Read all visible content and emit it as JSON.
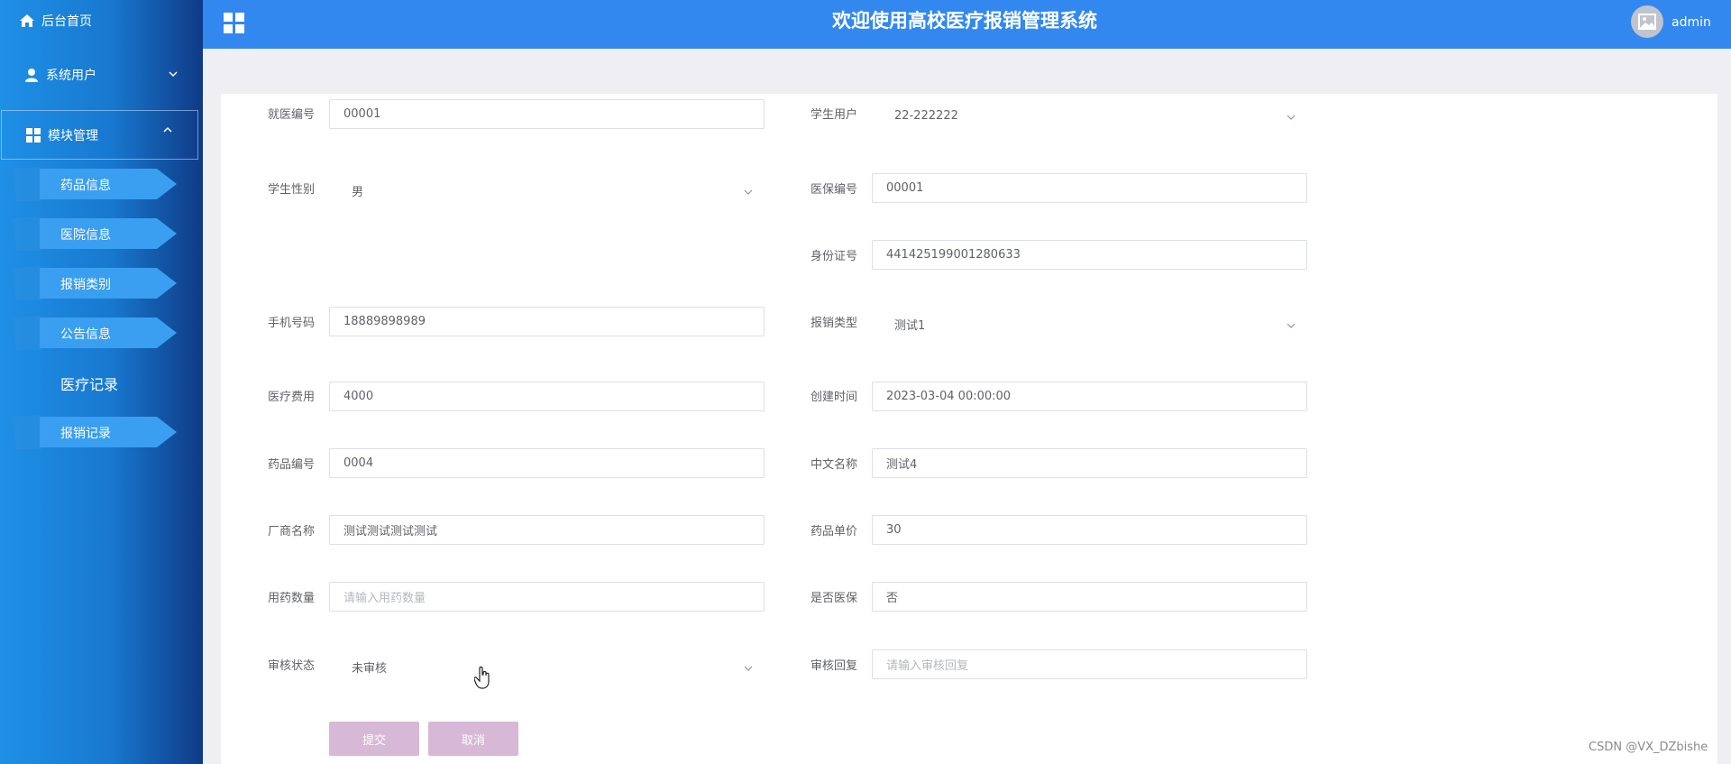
{
  "header": {
    "title": "欢迎使用高校医疗报销管理系统",
    "user": "admin"
  },
  "sidebar": {
    "home": "后台首页",
    "users": "系统用户",
    "modules": "模块管理",
    "items": [
      {
        "label": "药品信息"
      },
      {
        "label": "医院信息"
      },
      {
        "label": "报销类别"
      },
      {
        "label": "公告信息"
      },
      {
        "label": "医疗记录"
      },
      {
        "label": "报销记录"
      }
    ]
  },
  "form": {
    "visit_no": {
      "label": "就医编号",
      "value": "00001"
    },
    "student_user": {
      "label": "学生用户",
      "value": "22-222222"
    },
    "gender": {
      "label": "学生性别",
      "value": "男"
    },
    "insurance_no": {
      "label": "医保编号",
      "value": "00001"
    },
    "id_card": {
      "label": "身份证号",
      "value": "441425199001280633"
    },
    "phone": {
      "label": "手机号码",
      "value": "18889898989"
    },
    "reimb_type": {
      "label": "报销类型",
      "value": "测试1"
    },
    "medical_fee": {
      "label": "医疗费用",
      "value": "4000"
    },
    "created_at": {
      "label": "创建时间",
      "value": "2023-03-04 00:00:00"
    },
    "drug_no": {
      "label": "药品编号",
      "value": "0004"
    },
    "cn_name": {
      "label": "中文名称",
      "value": "测试4"
    },
    "maker": {
      "label": "厂商名称",
      "value": "测试测试测试测试"
    },
    "unit_price": {
      "label": "药品单价",
      "value": "30"
    },
    "dosage": {
      "label": "用药数量",
      "placeholder": "请输入用药数量"
    },
    "covered": {
      "label": "是否医保",
      "value": "否"
    },
    "audit_status": {
      "label": "审核状态",
      "value": "未审核"
    },
    "audit_reply": {
      "label": "审核回复",
      "placeholder": "请输入审核回复"
    }
  },
  "buttons": {
    "submit": "提交",
    "cancel": "取消"
  },
  "watermark": "CSDN @VX_DZbishe"
}
